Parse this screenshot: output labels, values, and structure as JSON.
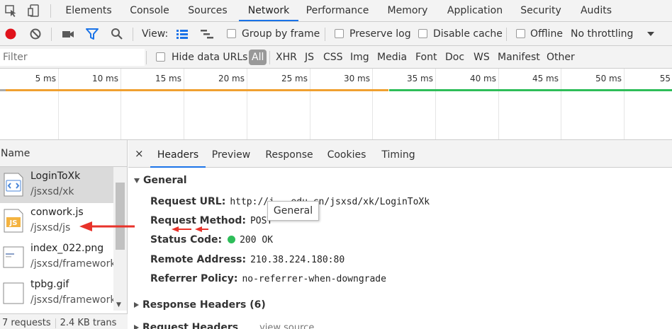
{
  "tabbar": {
    "tabs": [
      "Elements",
      "Console",
      "Sources",
      "Network",
      "Performance",
      "Memory",
      "Application",
      "Security",
      "Audits"
    ],
    "active_tab": "Network"
  },
  "toolbar": {
    "view_label": "View:",
    "group_by_frame": "Group by frame",
    "preserve_log": "Preserve log",
    "disable_cache": "Disable cache",
    "offline": "Offline",
    "throttling": "No throttling"
  },
  "filterbar": {
    "placeholder": "Filter",
    "hide_data_urls": "Hide data URLs",
    "types": [
      "All",
      "XHR",
      "JS",
      "CSS",
      "Img",
      "Media",
      "Font",
      "Doc",
      "WS",
      "Manifest",
      "Other"
    ],
    "active_type": "All"
  },
  "timeline": {
    "ticks": [
      "5 ms",
      "10 ms",
      "15 ms",
      "20 ms",
      "25 ms",
      "30 ms",
      "35 ms",
      "40 ms",
      "45 ms",
      "50 ms",
      "55"
    ]
  },
  "request_list": {
    "header": "Name",
    "requests": [
      {
        "name": "LoginToXk",
        "path": "/jsxsd/xk",
        "icon": "html-doc-icon",
        "selected": true
      },
      {
        "name": "conwork.js",
        "path": "/jsxsd/js",
        "icon": "js-file-icon",
        "selected": false
      },
      {
        "name": "index_022.png",
        "path": "/jsxsd/framework",
        "icon": "image-file-icon",
        "selected": false
      },
      {
        "name": "tpbg.gif",
        "path": "/jsxsd/framework",
        "icon": "image-file-icon",
        "selected": false
      }
    ],
    "status": {
      "requests": "7 requests",
      "transferred": "2.4 KB trans"
    }
  },
  "details": {
    "close": "×",
    "tabs": [
      "Headers",
      "Preview",
      "Response",
      "Cookies",
      "Timing"
    ],
    "active_tab": "Headers",
    "general": {
      "title": "General",
      "fields": [
        {
          "key": "Request URL:",
          "value": "http://j    .    edu.cn/jsxsd/xk/LoginToXk"
        },
        {
          "key": "Request Method:",
          "value": "POST"
        },
        {
          "key": "Status Code:",
          "value": "200 OK"
        },
        {
          "key": "Remote Address:",
          "value": "210.38.224.180:80"
        },
        {
          "key": "Referrer Policy:",
          "value": "no-referrer-when-downgrade"
        }
      ]
    },
    "response_headers": "Response Headers (6)",
    "request_headers": "Request Headers",
    "view_source": "view source"
  },
  "tooltip": "General",
  "colors": {
    "accent": "#1a73e8",
    "record": "#e0131b",
    "status_ok": "#2ebd59",
    "annotation": "#e8322a"
  }
}
